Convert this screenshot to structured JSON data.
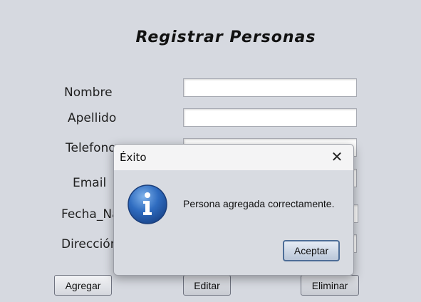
{
  "form": {
    "title": "Registrar Personas",
    "labels": {
      "nombre": "Nombre",
      "apellido": "Apellido",
      "telefono": "Telefono",
      "email": "Email",
      "fecha": "Fecha_Na",
      "direccion": "Dirección"
    },
    "fields": {
      "nombre": "",
      "apellido": "",
      "telefono": "",
      "email": "",
      "fecha": "",
      "direccion": ""
    },
    "buttons": {
      "agregar": "Agregar",
      "editar": "Editar",
      "eliminar": "Eliminar"
    }
  },
  "dialog": {
    "title": "Éxito",
    "close_glyph": "✕",
    "message": "Persona agregada correctamente.",
    "ok_label": "Aceptar",
    "icon": "information-icon"
  }
}
